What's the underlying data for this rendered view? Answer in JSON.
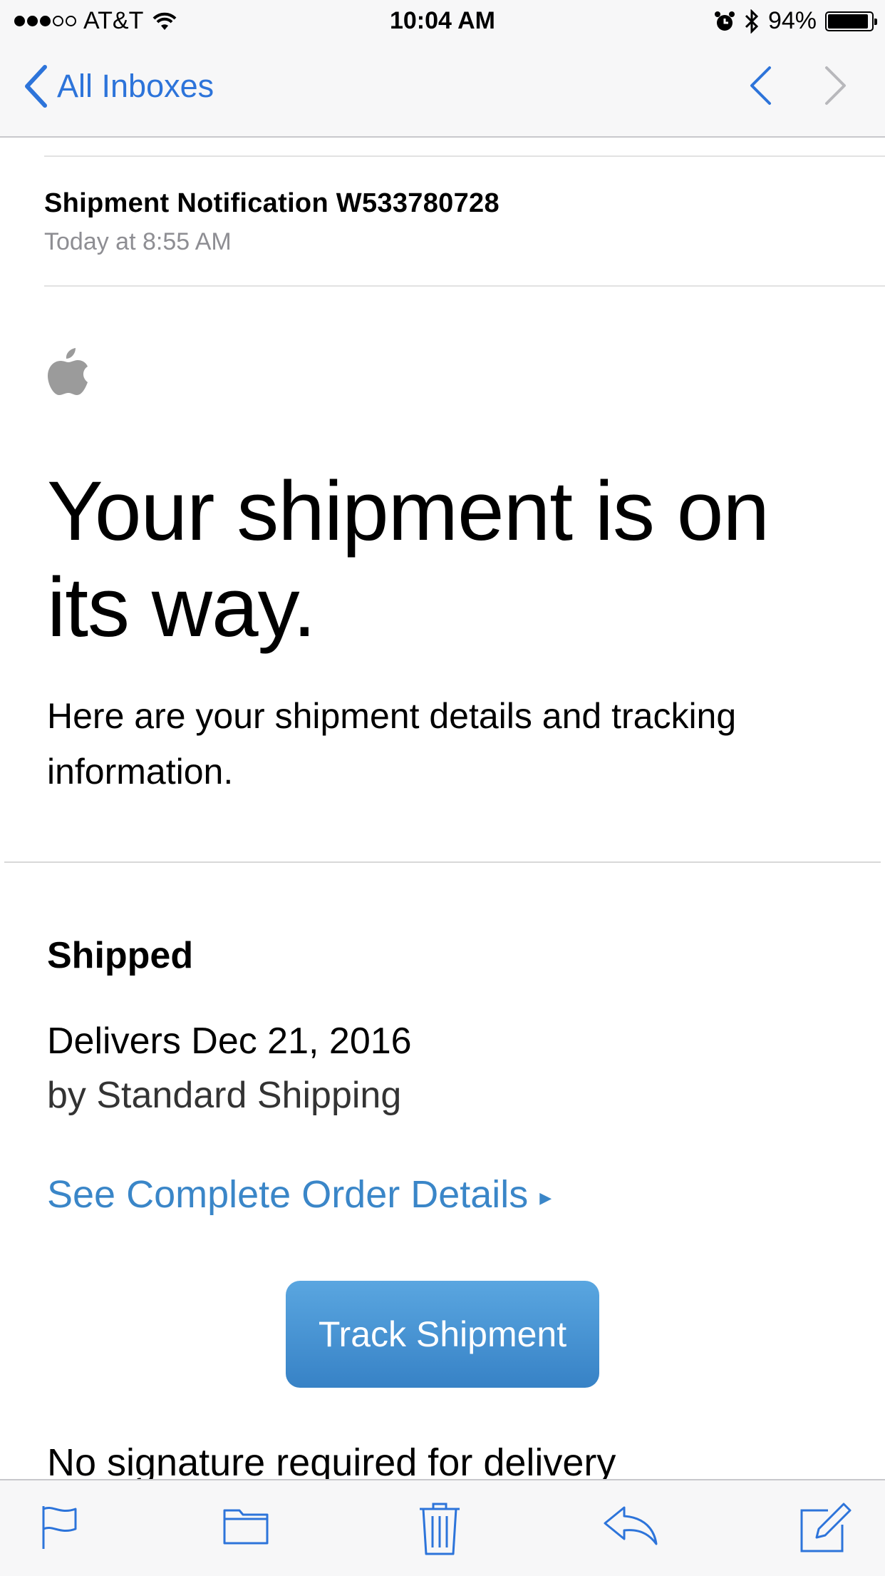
{
  "status_bar": {
    "carrier": "AT&T",
    "time": "10:04 AM",
    "battery": "94%",
    "battery_level": 0.94,
    "signal_bars_filled": 3,
    "signal_bars_total": 5
  },
  "nav": {
    "back_label": "All Inboxes",
    "accent_color": "#2d74da"
  },
  "message": {
    "subject": "Shipment Notification W533780728",
    "date": "Today at 8:55 AM"
  },
  "email": {
    "headline": "Your shipment is on its way.",
    "intro": "Here are your shipment details and tracking information.",
    "status_heading": "Shipped",
    "delivers": "Delivers Dec 21, 2016",
    "method": "by Standard Shipping",
    "order_link": "See Complete Order Details",
    "track_button": "Track Shipment",
    "signature_note": "No signature required for delivery",
    "link_color": "#3a86c8"
  },
  "toolbar": {
    "icons": [
      "flag-icon",
      "folder-icon",
      "trash-icon",
      "reply-icon",
      "compose-icon"
    ]
  }
}
